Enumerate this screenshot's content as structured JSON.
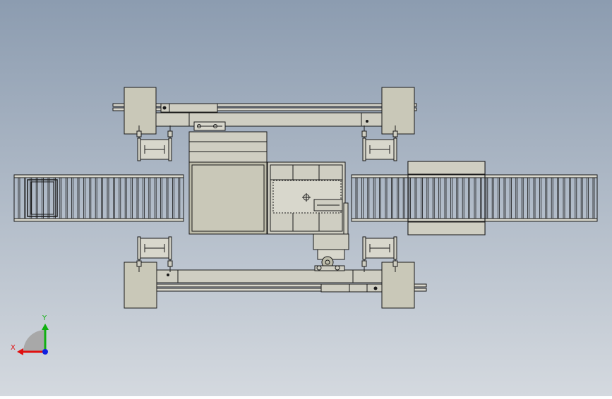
{
  "viewport": {
    "background_top": "#8c9cb0",
    "background_bottom": "#d4d9df",
    "part_fill": "#c9c8b8",
    "part_fill_dark": "#bdbcaa",
    "part_stroke": "#1a1a1a"
  },
  "triad": {
    "x_label": "X",
    "y_label": "Y",
    "x_color": "#e01010",
    "y_color": "#10b010",
    "z_color": "#1020e0"
  }
}
